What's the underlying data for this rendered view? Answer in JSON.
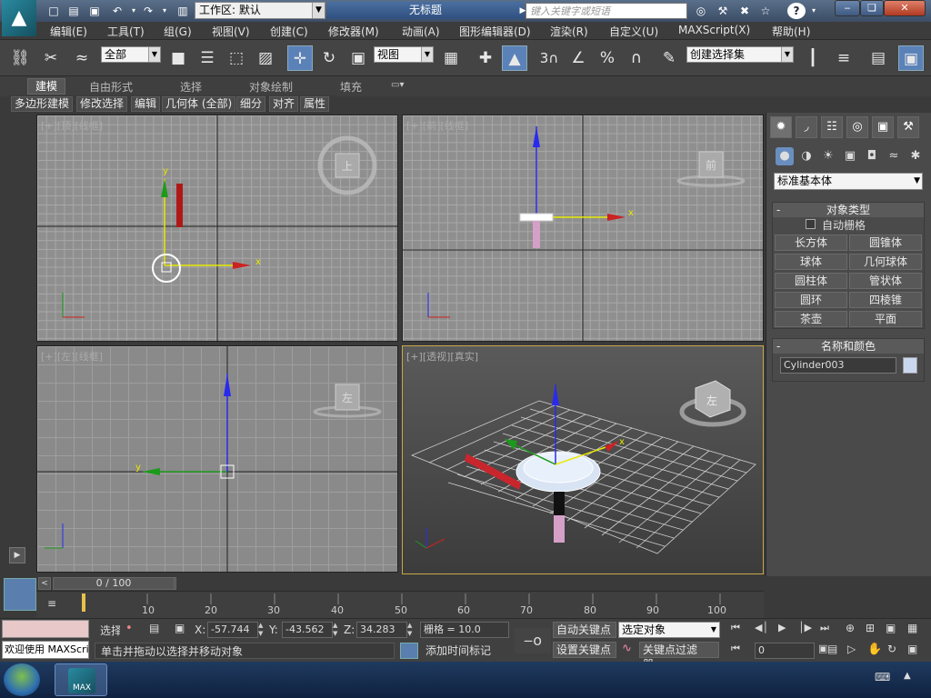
{
  "titlebar": {
    "workspace_label": "工作区: 默认",
    "doc_title": "无标题",
    "search_placeholder": "键入关键字或短语",
    "help_label": "?"
  },
  "menubar": {
    "items": [
      "编辑(E)",
      "工具(T)",
      "组(G)",
      "视图(V)",
      "创建(C)",
      "修改器(M)",
      "动画(A)",
      "图形编辑器(D)",
      "渲染(R)",
      "自定义(U)",
      "MAXScript(X)",
      "帮助(H)"
    ]
  },
  "toolbar": {
    "filter_select": "全部",
    "ref_coord_select": "视图",
    "named_selection_select": "创建选择集",
    "snap_label": "3",
    "percent_label": "%"
  },
  "ribbon": {
    "tabs": [
      "建模",
      "自由形式",
      "选择",
      "对象绘制",
      "填充"
    ],
    "sub_items": [
      "多边形建模",
      "修改选择",
      "编辑",
      "几何体 (全部)",
      "细分",
      "对齐",
      "属性"
    ]
  },
  "viewports": {
    "top": {
      "l1": "[+]",
      "l2": "[顶]",
      "l3": "[线框]"
    },
    "front": {
      "l1": "[+]",
      "l2": "[前]",
      "l3": "[线框]"
    },
    "left": {
      "l1": "[+]",
      "l2": "[左]",
      "l3": "[线框]"
    },
    "persp": {
      "l1": "[+]",
      "l2": "[透视]",
      "l3": "[真实]"
    },
    "gizmo_label_top": "上",
    "gizmo_label_front": "前",
    "gizmo_label_left": "左",
    "gizmo_label_persp": "左"
  },
  "command_panel": {
    "primitive_select": "标准基本体",
    "object_type_title": "对象类型",
    "auto_grid_label": "自动栅格",
    "buttons": [
      "长方体",
      "圆锥体",
      "球体",
      "几何球体",
      "圆柱体",
      "管状体",
      "圆环",
      "四棱锥",
      "茶壶",
      "平面"
    ],
    "name_color_title": "名称和颜色",
    "object_name": "Cylinder003",
    "object_color": "#c9d8ef"
  },
  "timeline": {
    "slider_label": "0 / 100",
    "ticks": [
      "10",
      "20",
      "30",
      "40",
      "50",
      "60",
      "70",
      "80",
      "90",
      "100"
    ]
  },
  "status": {
    "selected_label": "选择",
    "x_label": "X:",
    "x_value": "-57.744",
    "y_label": "Y:",
    "y_value": "-43.562",
    "z_label": "Z:",
    "z_value": "34.283",
    "grid_label": "栅格 = 10.0",
    "auto_key_label": "自动关键点",
    "set_key_label": "设置关键点",
    "key_mode_select": "选定对象",
    "key_filter_label": "关键点过滤器...",
    "frame_value": "0",
    "prompt_text": "单击并拖动以选择并移动对象",
    "add_time_tag_label": "添加时间标记",
    "maxscript_listener": "欢迎使用 MAXScri"
  },
  "taskbar": {
    "max_label": "MAX"
  }
}
